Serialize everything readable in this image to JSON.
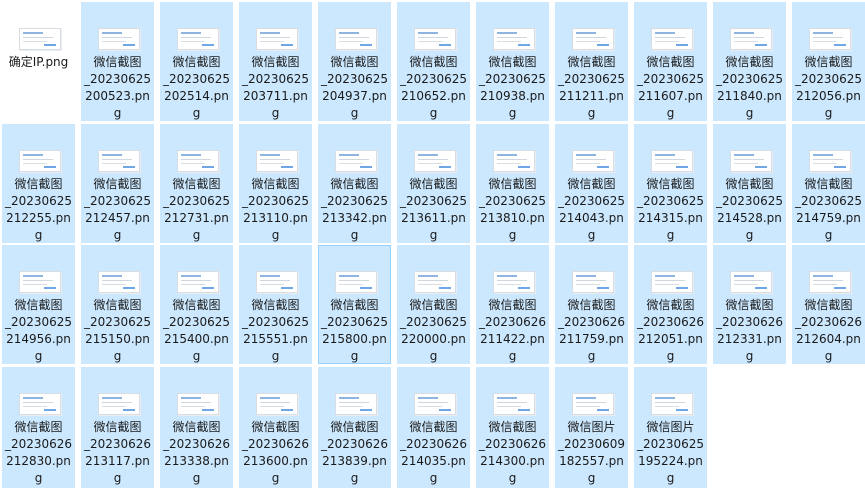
{
  "files": [
    {
      "label": "确定IP.png",
      "selected": false
    },
    {
      "label": "微信截图\n_20230625\n200523.pn\ng",
      "selected": true
    },
    {
      "label": "微信截图\n_20230625\n202514.pn\ng",
      "selected": true
    },
    {
      "label": "微信截图\n_20230625\n203711.pn\ng",
      "selected": true
    },
    {
      "label": "微信截图\n_20230625\n204937.pn\ng",
      "selected": true
    },
    {
      "label": "微信截图\n_20230625\n210652.pn\ng",
      "selected": true
    },
    {
      "label": "微信截图\n_20230625\n210938.pn\ng",
      "selected": true
    },
    {
      "label": "微信截图\n_20230625\n211211.pn\ng",
      "selected": true
    },
    {
      "label": "微信截图\n_20230625\n211607.pn\ng",
      "selected": true
    },
    {
      "label": "微信截图\n_20230625\n211840.pn\ng",
      "selected": true
    },
    {
      "label": "微信截图\n_20230625\n212056.pn\ng",
      "selected": true
    },
    {
      "label": "微信截图\n_20230625\n212255.pn\ng",
      "selected": true
    },
    {
      "label": "微信截图\n_20230625\n212457.pn\ng",
      "selected": true
    },
    {
      "label": "微信截图\n_20230625\n212731.pn\ng",
      "selected": true
    },
    {
      "label": "微信截图\n_20230625\n213110.pn\ng",
      "selected": true
    },
    {
      "label": "微信截图\n_20230625\n213342.pn\ng",
      "selected": true
    },
    {
      "label": "微信截图\n_20230625\n213611.pn\ng",
      "selected": true
    },
    {
      "label": "微信截图\n_20230625\n213810.pn\ng",
      "selected": true
    },
    {
      "label": "微信截图\n_20230625\n214043.pn\ng",
      "selected": true
    },
    {
      "label": "微信截图\n_20230625\n214315.pn\ng",
      "selected": true
    },
    {
      "label": "微信截图\n_20230625\n214528.pn\ng",
      "selected": true
    },
    {
      "label": "微信截图\n_20230625\n214759.pn\ng",
      "selected": true
    },
    {
      "label": "微信截图\n_20230625\n214956.pn\ng",
      "selected": true
    },
    {
      "label": "微信截图\n_20230625\n215150.pn\ng",
      "selected": true
    },
    {
      "label": "微信截图\n_20230625\n215400.pn\ng",
      "selected": true
    },
    {
      "label": "微信截图\n_20230625\n215551.pn\ng",
      "selected": true
    },
    {
      "label": "微信截图\n_20230625\n215800.pn\ng",
      "selected": true,
      "focused": true
    },
    {
      "label": "微信截图\n_20230625\n220000.pn\ng",
      "selected": true
    },
    {
      "label": "微信截图\n_20230626\n211422.pn\ng",
      "selected": true
    },
    {
      "label": "微信截图\n_20230626\n211759.pn\ng",
      "selected": true
    },
    {
      "label": "微信截图\n_20230626\n212051.pn\ng",
      "selected": true
    },
    {
      "label": "微信截图\n_20230626\n212331.pn\ng",
      "selected": true
    },
    {
      "label": "微信截图\n_20230626\n212604.pn\ng",
      "selected": true
    },
    {
      "label": "微信截图\n_20230626\n212830.pn\ng",
      "selected": true
    },
    {
      "label": "微信截图\n_20230626\n213117.pn\ng",
      "selected": true
    },
    {
      "label": "微信截图\n_20230626\n213338.pn\ng",
      "selected": true
    },
    {
      "label": "微信截图\n_20230626\n213600.pn\ng",
      "selected": true
    },
    {
      "label": "微信截图\n_20230626\n213839.pn\ng",
      "selected": true
    },
    {
      "label": "微信截图\n_20230626\n214035.pn\ng",
      "selected": true
    },
    {
      "label": "微信截图\n_20230626\n214300.pn\ng",
      "selected": true
    },
    {
      "label": "微信图片\n_20230609\n182557.pn\ng",
      "selected": true
    },
    {
      "label": "微信图片\n_20230625\n195224.pn\ng",
      "selected": true
    }
  ],
  "colors": {
    "selection_fill": "#cce8ff",
    "focus_border": "#99d1ff"
  },
  "icons": {
    "file_thumbnail": "image-thumbnail-icon"
  }
}
